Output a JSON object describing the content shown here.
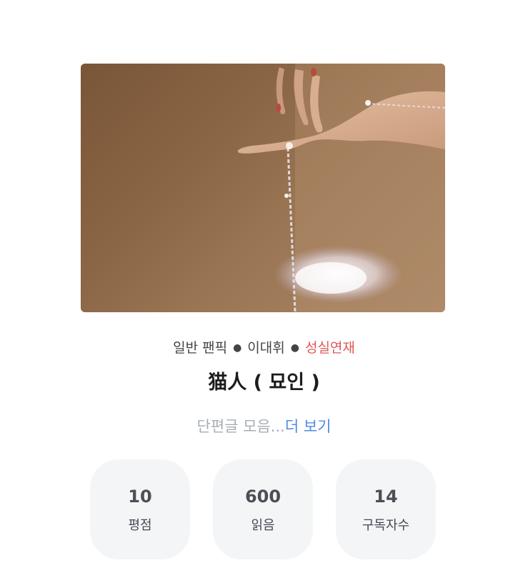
{
  "meta": {
    "genre": "일반 팬픽",
    "character": "이대휘",
    "status": "성실연재",
    "status_color": "#e05656"
  },
  "work": {
    "title": "猫人 ( 묘인 )",
    "description": "단편글 모음...",
    "more_label": "더 보기"
  },
  "stats": [
    {
      "value": "10",
      "label": "평점"
    },
    {
      "value": "600",
      "label": "읽음"
    },
    {
      "value": "14",
      "label": "구독자수"
    }
  ],
  "colors": {
    "link": "#4f8ae8",
    "muted_text": "#a7adb6",
    "stat_bg": "#f4f5f7"
  }
}
